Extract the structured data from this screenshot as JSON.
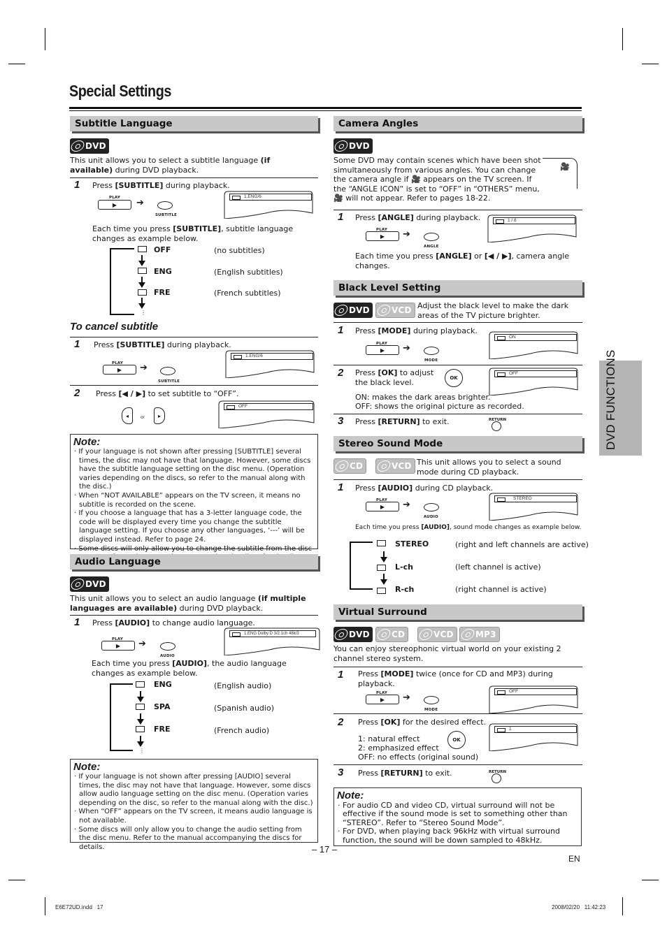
{
  "page": {
    "title": "Special Settings",
    "page_number": "– 17 –",
    "language": "EN",
    "side_tab": "DVD FUNCTIONS",
    "footer_left": "E6E72UD.indd   17",
    "footer_right": "2008/02/20   11:42:23"
  },
  "buttons": {
    "play": "PLAY",
    "play_glyph": "▶",
    "arrow": "➔",
    "subtitle": "SUBTITLE",
    "audio": "AUDIO",
    "angle": "ANGLE",
    "mode": "MODE",
    "ok": "OK",
    "return": "RETURN",
    "or": "or",
    "left_glyph": "◂",
    "right_glyph": "▸"
  },
  "subtitle": {
    "heading": "Subtitle Language",
    "badges": [
      "DVD"
    ],
    "intro": "This unit allows you to select a subtitle language",
    "intro_bold": "(if available)",
    "intro_tail": "during DVD playback.",
    "step1_num": "1",
    "step1_pre": "Press ",
    "step1_key": "[SUBTITLE]",
    "step1_post": " during playback.",
    "screen1": "1.ENG/6",
    "each_pre": "Each time you press ",
    "each_key": "[SUBTITLE]",
    "each_post": ", subtitle language changes as example below.",
    "cycle": [
      {
        "code": "OFF",
        "desc": "(no subtitles)"
      },
      {
        "code": "ENG",
        "desc": "(English subtitles)"
      },
      {
        "code": "FRE",
        "desc": "(French subtitles)"
      }
    ],
    "cycle_more": "⋮",
    "cancel_heading": "To cancel subtitle",
    "cancel_step1_num": "1",
    "cancel_step1_pre": "Press ",
    "cancel_step1_key": "[SUBTITLE]",
    "cancel_step1_post": " during playback.",
    "cancel_screen1": "1.ENG/6",
    "cancel_step2_num": "2",
    "cancel_step2_pre": "Press ",
    "cancel_step2_key": "[◀ / ▶]",
    "cancel_step2_post": " to set subtitle to “OFF”.",
    "cancel_screen2": "OFF",
    "note_title": "Note:",
    "notes": [
      "If your language is not shown after pressing [SUBTITLE] several times, the disc may not have that language. However, some discs have the subtitle language setting on the disc menu. (Operation varies depending on the discs, so refer to the manual along with the disc.)",
      "When “NOT AVAILABLE” appears on the TV screen, it means no subtitle is recorded on the scene.",
      "If you choose a language that has a 3-letter language code, the code will be displayed every time you change the subtitle language setting. If you choose any other languages, ‘---’ will be displayed instead. Refer to page 24.",
      "Some discs will only allow you to change the subtitle from the disc menu. Refer to the manual accompanying the discs for details."
    ]
  },
  "audio": {
    "heading": "Audio Language",
    "badges": [
      "DVD"
    ],
    "intro": "This unit allows you to select an audio language",
    "intro_bold": "(if multiple languages are available)",
    "intro_tail": "during DVD playback.",
    "step1_num": "1",
    "step1_pre": "Press ",
    "step1_key": "[AUDIO]",
    "step1_post": " to change audio language.",
    "screen1": "1.ENG  Dolby D  3/2.1ch  48k/3",
    "each_pre": "Each time you press ",
    "each_key": "[AUDIO]",
    "each_post": ", the audio language changes as example below.",
    "cycle": [
      {
        "code": "ENG",
        "desc": "(English audio)"
      },
      {
        "code": "SPA",
        "desc": "(Spanish audio)"
      },
      {
        "code": "FRE",
        "desc": "(French audio)"
      }
    ],
    "cycle_more": "⋮",
    "note_title": "Note:",
    "notes": [
      "If your language is not shown after pressing [AUDIO] several times, the disc may not have that language. However, some discs allow audio language setting on the disc menu. (Operation varies depending on the disc, so refer to the manual along with the disc.)",
      "When “OFF” appears on the TV screen, it means audio language is not available.",
      "Some discs will only allow you to change the audio setting from the disc menu. Refer to the manual accompanying the discs for details."
    ]
  },
  "camera": {
    "heading": "Camera Angles",
    "badges": [
      "DVD"
    ],
    "intro": "Some DVD may contain scenes which have been shot simultaneously from various angles. You can change the camera angle if 🎥 appears on the TV screen. If the “ANGLE ICON” is set to “OFF” in “OTHERS” menu, 🎥 will not appear. Refer to pages 18-22.",
    "step1_num": "1",
    "step1_pre": "Press ",
    "step1_key": "[ANGLE]",
    "step1_post": " during playback.",
    "screen1": "1 / 8",
    "each_pre": "Each time you press ",
    "each_key": "[ANGLE]",
    "each_mid": " or ",
    "each_key2": "[◀ / ▶]",
    "each_post": ", camera angle changes."
  },
  "black_level": {
    "heading": "Black Level Setting",
    "badges": [
      "DVD",
      "VCD"
    ],
    "intro": "Adjust the black level to make the dark areas of the TV picture brighter.",
    "step1_num": "1",
    "step1_pre": "Press ",
    "step1_key": "[MODE]",
    "step1_post": " during playback.",
    "screen1": "ON",
    "step2_num": "2",
    "step2_pre": "Press ",
    "step2_key": "[OK]",
    "step2_post": " to adjust the black level.",
    "screen2": "OFF",
    "on_desc": "ON: makes the dark areas brighter.",
    "off_desc": "OFF: shows the original picture as recorded.",
    "step3_num": "3",
    "step3_pre": "Press ",
    "step3_key": "[RETURN]",
    "step3_post": " to exit."
  },
  "stereo": {
    "heading": "Stereo Sound Mode",
    "badges": [
      "CD",
      "VCD"
    ],
    "intro": "This unit allows you to select a sound mode during CD playback.",
    "step1_num": "1",
    "step1_pre": "Press ",
    "step1_key": "[AUDIO]",
    "step1_post": " during CD playback.",
    "screen1": "STEREO",
    "each_pre": "Each time you press ",
    "each_key": "[AUDIO]",
    "each_post": ", sound mode changes as example below.",
    "cycle": [
      {
        "code": "STEREO",
        "desc": "(right and left channels are active)"
      },
      {
        "code": "L-ch",
        "desc": "(left channel is active)"
      },
      {
        "code": "R-ch",
        "desc": "(right channel is active)"
      }
    ]
  },
  "virtual": {
    "heading": "Virtual Surround",
    "badges": [
      "DVD",
      "CD",
      "VCD",
      "MP3"
    ],
    "intro": "You can enjoy stereophonic virtual world on your existing 2 channel stereo system.",
    "step1_num": "1",
    "step1_pre": "Press ",
    "step1_key": "[MODE]",
    "step1_post": " twice (once for CD and MP3) during playback.",
    "screen1": "OFF",
    "step2_num": "2",
    "step2_pre": "Press ",
    "step2_key": "[OK]",
    "step2_post": " for the desired effect.",
    "screen2": "1",
    "opt1": "1: natural effect",
    "opt2": "2: emphasized effect",
    "opt3": "OFF: no effects (original sound)",
    "step3_num": "3",
    "step3_pre": "Press ",
    "step3_key": "[RETURN]",
    "step3_post": " to exit.",
    "note_title": "Note:",
    "notes": [
      "For audio CD and video CD, virtual surround will not be effective if the sound mode is set to something other than “STEREO”. Refer to “Stereo Sound Mode”.",
      "For DVD, when playing back 96kHz with virtual surround function, the sound will be down sampled to 48kHz."
    ]
  }
}
